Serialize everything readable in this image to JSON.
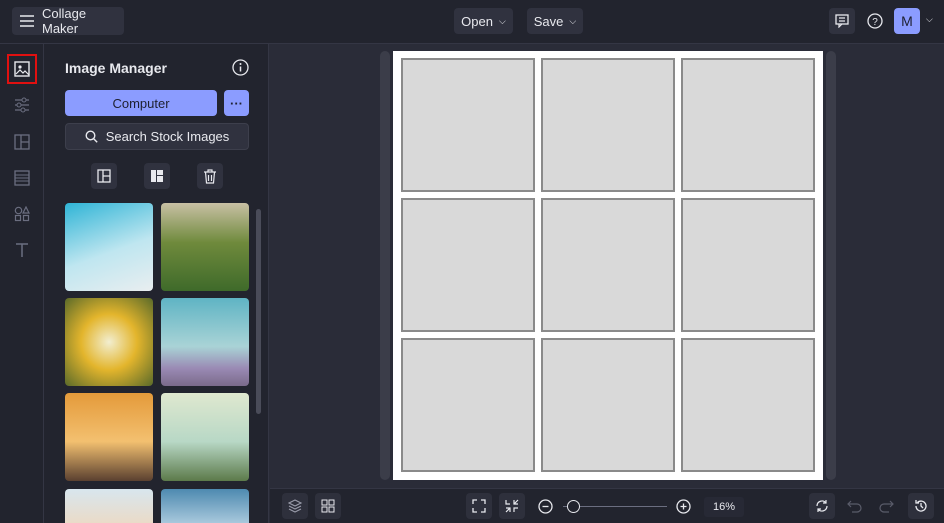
{
  "header": {
    "app_title": "Collage Maker",
    "open_label": "Open",
    "save_label": "Save",
    "avatar_initial": "M"
  },
  "rail": {
    "items": [
      "image-manager",
      "adjustments",
      "layouts",
      "backgrounds",
      "graphics",
      "text"
    ],
    "active": "image-manager"
  },
  "panel": {
    "title": "Image Manager",
    "computer_label": "Computer",
    "more_label": "···",
    "search_label": "Search Stock Images"
  },
  "thumbnails": [
    "instant camera in sky",
    "sneakers in grass",
    "yellow flowers",
    "birds over meadow",
    "birds at sunset",
    "palm tree",
    "beach",
    "window"
  ],
  "canvas": {
    "rows": 3,
    "cols": 3
  },
  "footer": {
    "zoom_value": "16%",
    "zoom_fraction": 0.04
  },
  "colors": {
    "accent": "#8b9cff",
    "highlight": "#e01010"
  }
}
